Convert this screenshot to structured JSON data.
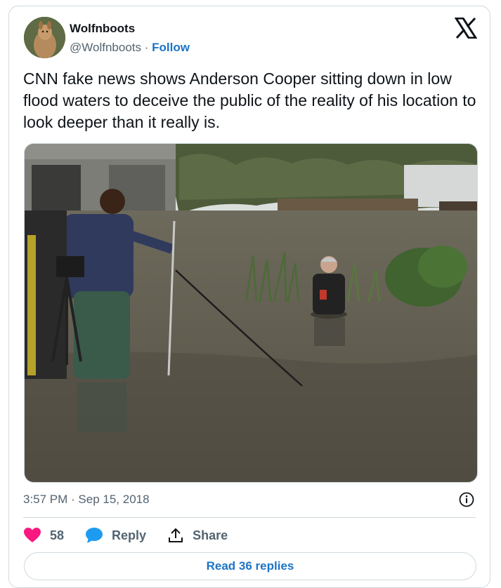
{
  "author": {
    "name": "Wolfnboots",
    "handle": "@Wolfnboots",
    "separator": "·",
    "follow_label": "Follow"
  },
  "tweet": {
    "text": "CNN fake news shows Anderson Cooper sitting down in low flood waters to deceive the public of the reality of his location to look deeper than it really is.",
    "timestamp": "3:57 PM · Sep 15, 2018"
  },
  "actions": {
    "likes": "58",
    "reply_label": "Reply",
    "share_label": "Share"
  },
  "read_replies_label": "Read 36 replies",
  "colors": {
    "accent": "#1d74c4",
    "like": "#f91880",
    "border": "#cfd9de",
    "muted": "#536471"
  }
}
